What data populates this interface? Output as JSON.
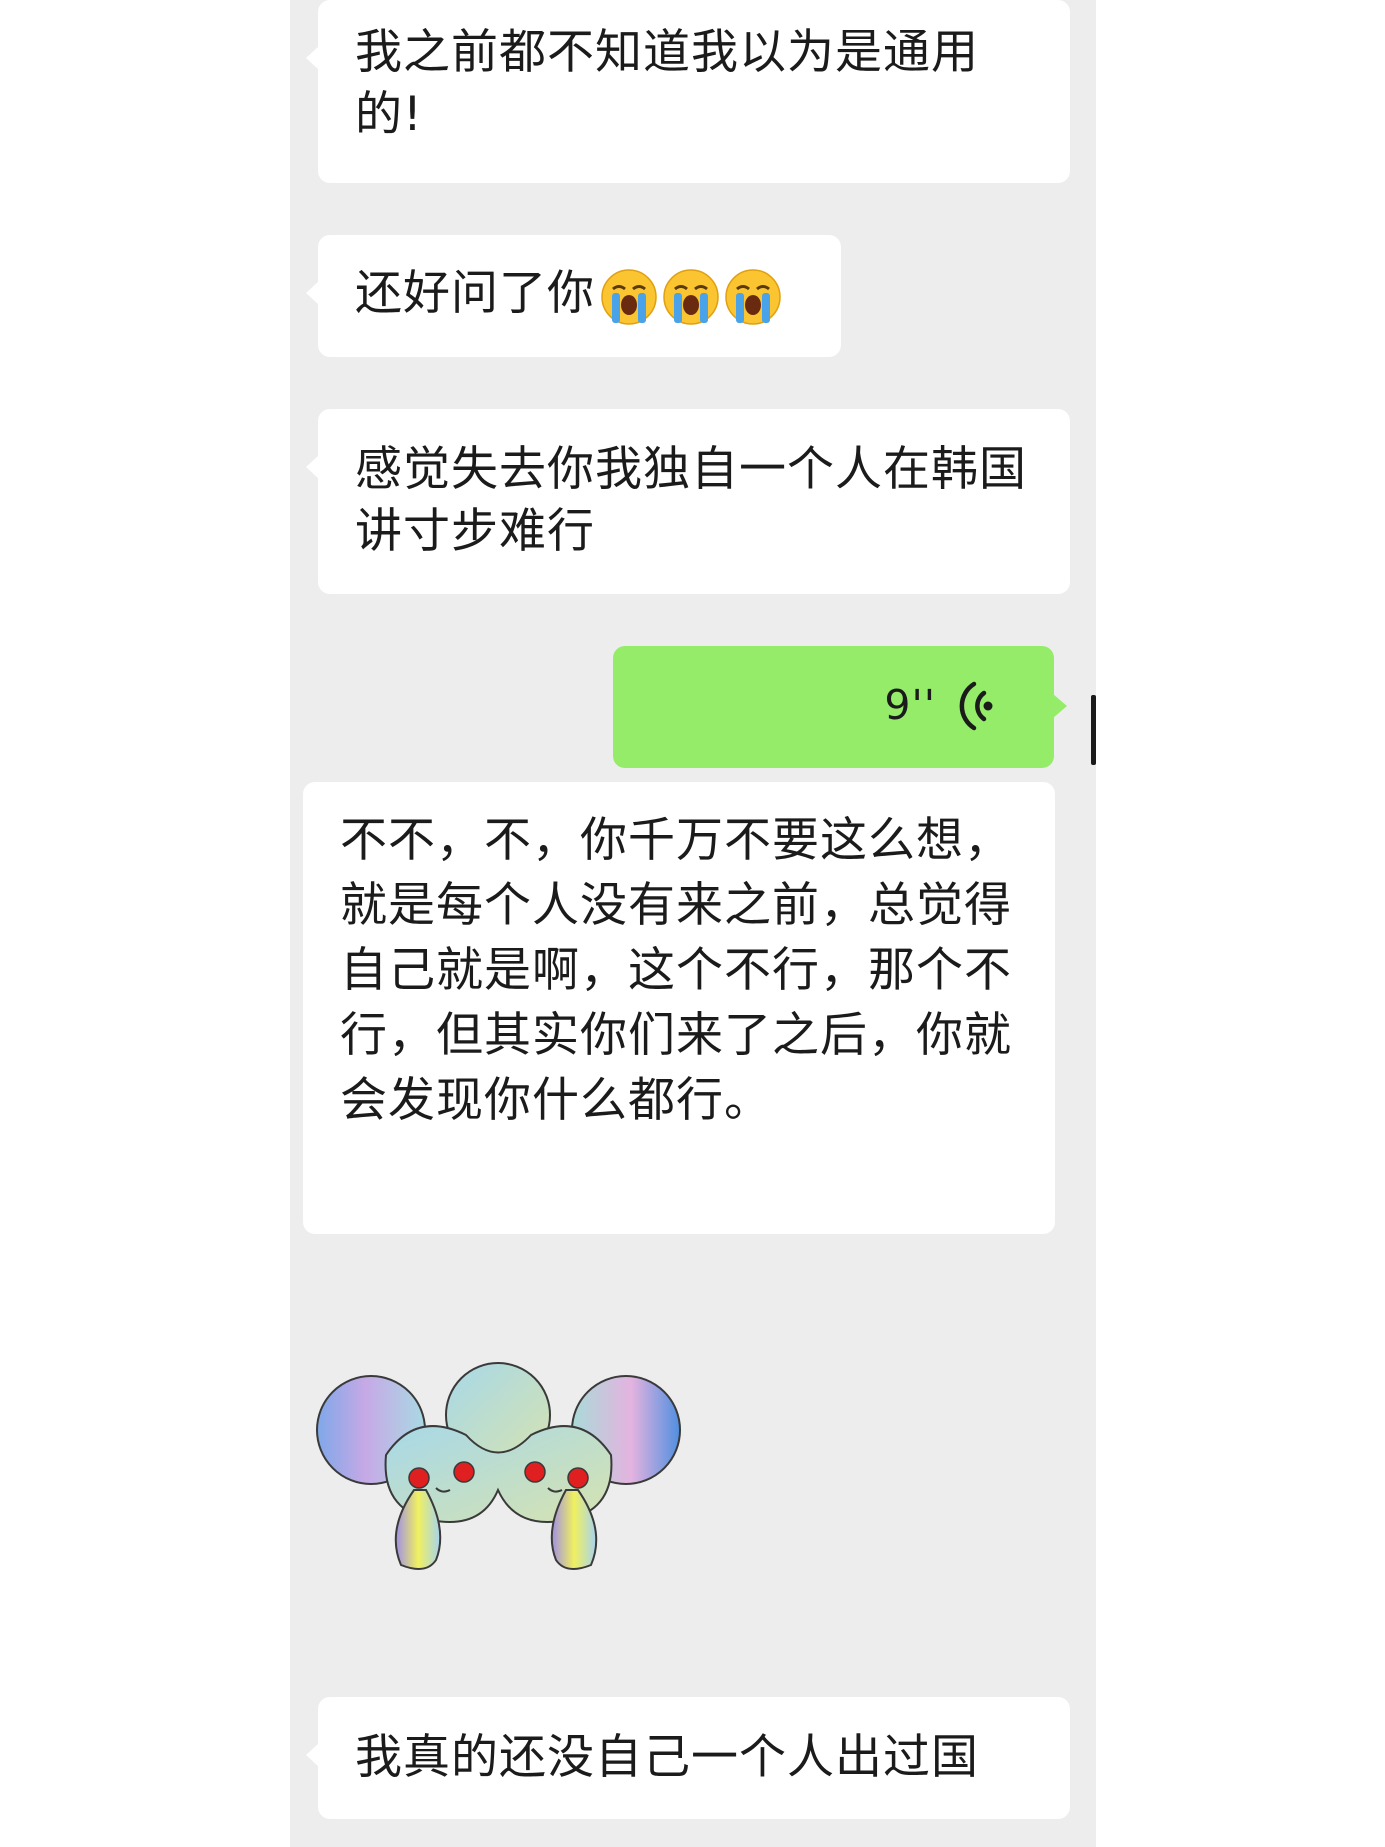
{
  "messages": [
    {
      "id": "m1",
      "side": "received",
      "type": "text",
      "text": "我之前都不知道我以为是通用的!"
    },
    {
      "id": "m2",
      "side": "received",
      "type": "text",
      "text": "还好问了你",
      "emoji": [
        "loudly-crying-face",
        "loudly-crying-face",
        "loudly-crying-face"
      ]
    },
    {
      "id": "m3",
      "side": "received",
      "type": "text",
      "text": "感觉失去你我独自一个人在韩国讲寸步难行"
    },
    {
      "id": "m4",
      "side": "sent",
      "type": "voice",
      "duration": "9''",
      "icon": "voice-wave-icon"
    },
    {
      "id": "m5",
      "side": "received",
      "type": "text",
      "text": "不不，不，你千万不要这么想，就是每个人没有来之前，总觉得自己就是啊，这个不行，那个不行，但其实你们来了之后，你就会发现你什么都行。"
    },
    {
      "id": "m6",
      "side": "received",
      "type": "sticker",
      "sticker": "crying-mouse-sticker"
    },
    {
      "id": "m7",
      "side": "received",
      "type": "text",
      "text": "我真的还没自己一个人出过国"
    }
  ],
  "colors": {
    "chat_background": "#ededed",
    "page_background": "#ffffff",
    "received_bubble": "#ffffff",
    "sent_bubble": "#95ec69",
    "text": "#1b1b1b"
  }
}
